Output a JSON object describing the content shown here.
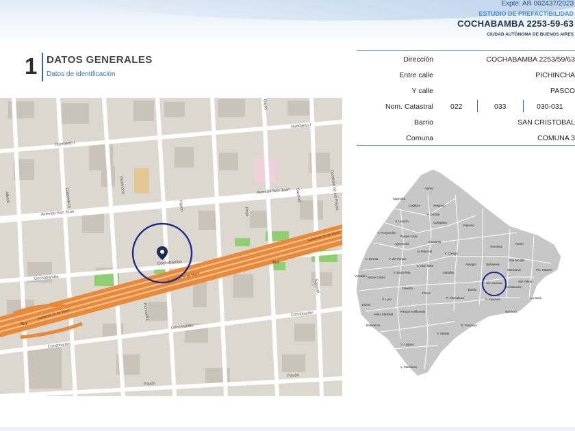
{
  "header": {
    "expte": "Expte: AR 002437/2023",
    "study": "ESTUDIO DE PREFACTIBILIDAD",
    "address": "COCHABAMBA 2253-59-63",
    "city": "CIUDAD AUTÓNOMA DE BUENOS AIRES"
  },
  "section": {
    "number": "1",
    "title": "DATOS GENERALES",
    "subtitle": "Datos de identificación"
  },
  "info": {
    "direccion": {
      "label": "Dirección",
      "value": "COCHABAMBA 2253/59/63"
    },
    "entre_calle": {
      "label": "Entre calle",
      "value": "PICHINCHA"
    },
    "y_calle": {
      "label": "Y calle",
      "value": "PASCO"
    },
    "nom_catastral": {
      "label": "Nom. Catastral",
      "values": [
        "022",
        "033",
        "030-031"
      ]
    },
    "barrio": {
      "label": "Barrio",
      "value": "SAN CRISTOBAL"
    },
    "comuna": {
      "label": "Comuna",
      "value": "COMUNA 3"
    }
  },
  "street_map": {
    "streets": {
      "humberto1": "Humberto I",
      "san_juan_left": "Avenida San Juan",
      "san_juan_right": "Avenida San Juan",
      "cochabamba_left": "Cochabamba",
      "cochabamba_center": "Cochabamba",
      "constitucion_left": "Constitución",
      "constitucion_mid": "Constitución",
      "constitucion_right": "Constitución",
      "pavon_left": "Pavón",
      "pavon_right": "Pavón",
      "pichincha_top": "Pichincha",
      "pichincha_bottom": "Pichincha",
      "pasco": "Pasco",
      "rioja": "Rioja",
      "sarandi_top": "Sarandí",
      "sarandi_bottom": "Sarandí",
      "garay": "Garay",
      "combate": "Combate de los Pozos",
      "catamarca": "Catamarca",
      "alberti": "Alberti",
      "autopista_top": "Autopista 25 de Mayo",
      "autopista_left": "Autopista 25 de Mayo",
      "autopista_center": "Autopista 25 de Mayo",
      "au1": "AU1",
      "au1b": "AU1"
    },
    "pin_icon": "map-pin-icon"
  },
  "comunas_map": {
    "labels": [
      "Núñez",
      "Saavedra",
      "Coghlan",
      "Belgrano",
      "V. Urquiza",
      "V. Ortúzar",
      "Colegiales",
      "Palermo",
      "V. Pueyrredón",
      "Parque Chas",
      "Agronomía",
      "Chacarita",
      "Recoleta",
      "Retiro",
      "La Paternal",
      "V. Crespo",
      "V. Devoto",
      "V. del Parque",
      "V. Gral. Mitre",
      "Almagro",
      "Balvanera",
      "San Nicolás",
      "Monte Castro",
      "V. Santa Rita",
      "Caballito",
      "Monserrat",
      "Pto. Madero",
      "Versalles",
      "Floresta",
      "Boedo",
      "San Cristóbal",
      "San Telmo",
      "Liniers",
      "V. Luro",
      "Vélez Sársfield",
      "Flores",
      "P. Chacabuco",
      "Constitución",
      "Parque Avellaneda",
      "P. Patricios",
      "La Boca",
      "Mataderos",
      "Barracas",
      "V. Soldati",
      "N. Pompeya",
      "V. Lugano",
      "V. Riachuelo"
    ],
    "highlight": "San Cristóbal"
  }
}
